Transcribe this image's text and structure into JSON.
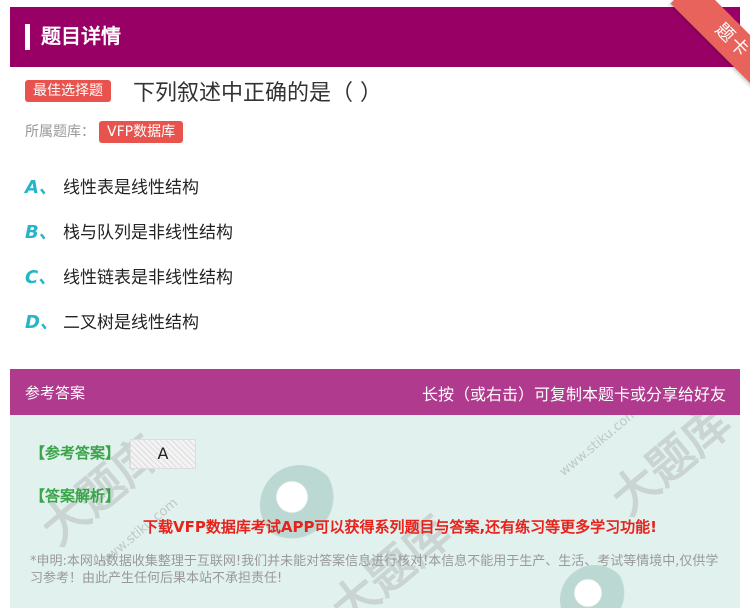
{
  "header": {
    "title": "题目详情"
  },
  "ribbon": {
    "label": "题卡"
  },
  "question": {
    "type_tag": "最佳选择题",
    "text": "下列叙述中正确的是（   ）",
    "bank_label": "所属题库：",
    "bank_name": "VFP数据库"
  },
  "options": [
    {
      "letter": "A、",
      "text": "线性表是线性结构"
    },
    {
      "letter": "B、",
      "text": "栈与队列是非线性结构"
    },
    {
      "letter": "C、",
      "text": "线性链表是非线性结构"
    },
    {
      "letter": "D、",
      "text": "二叉树是线性结构"
    }
  ],
  "answer_panel": {
    "title": "参考答案",
    "hint": "长按（或右击）可复制本题卡或分享给好友",
    "ref_label": "【参考答案】",
    "ref_value": "A",
    "analysis_label": "【答案解析】",
    "promo": "下载VFP数据库考试APP可以获得系列题目与答案,还有练习等更多学习功能!",
    "disclaimer": "*申明:本网站数据收集整理于互联网!我们并未能对答案信息进行核对!本信息不能用于生产、生活、考试等情境中,仅供学习参考！由此产生任何后果本站不承担责任!"
  },
  "watermark": {
    "brand": "大题库",
    "site": "www.stiku.com"
  },
  "colors": {
    "header": "#990066",
    "tag": "#e8544d",
    "option_letter": "#26b5c8",
    "answer_bar": "#b03a8e",
    "answer_bg": "#e1f1ee",
    "green_label": "#3aa548",
    "promo": "#e8211b"
  }
}
